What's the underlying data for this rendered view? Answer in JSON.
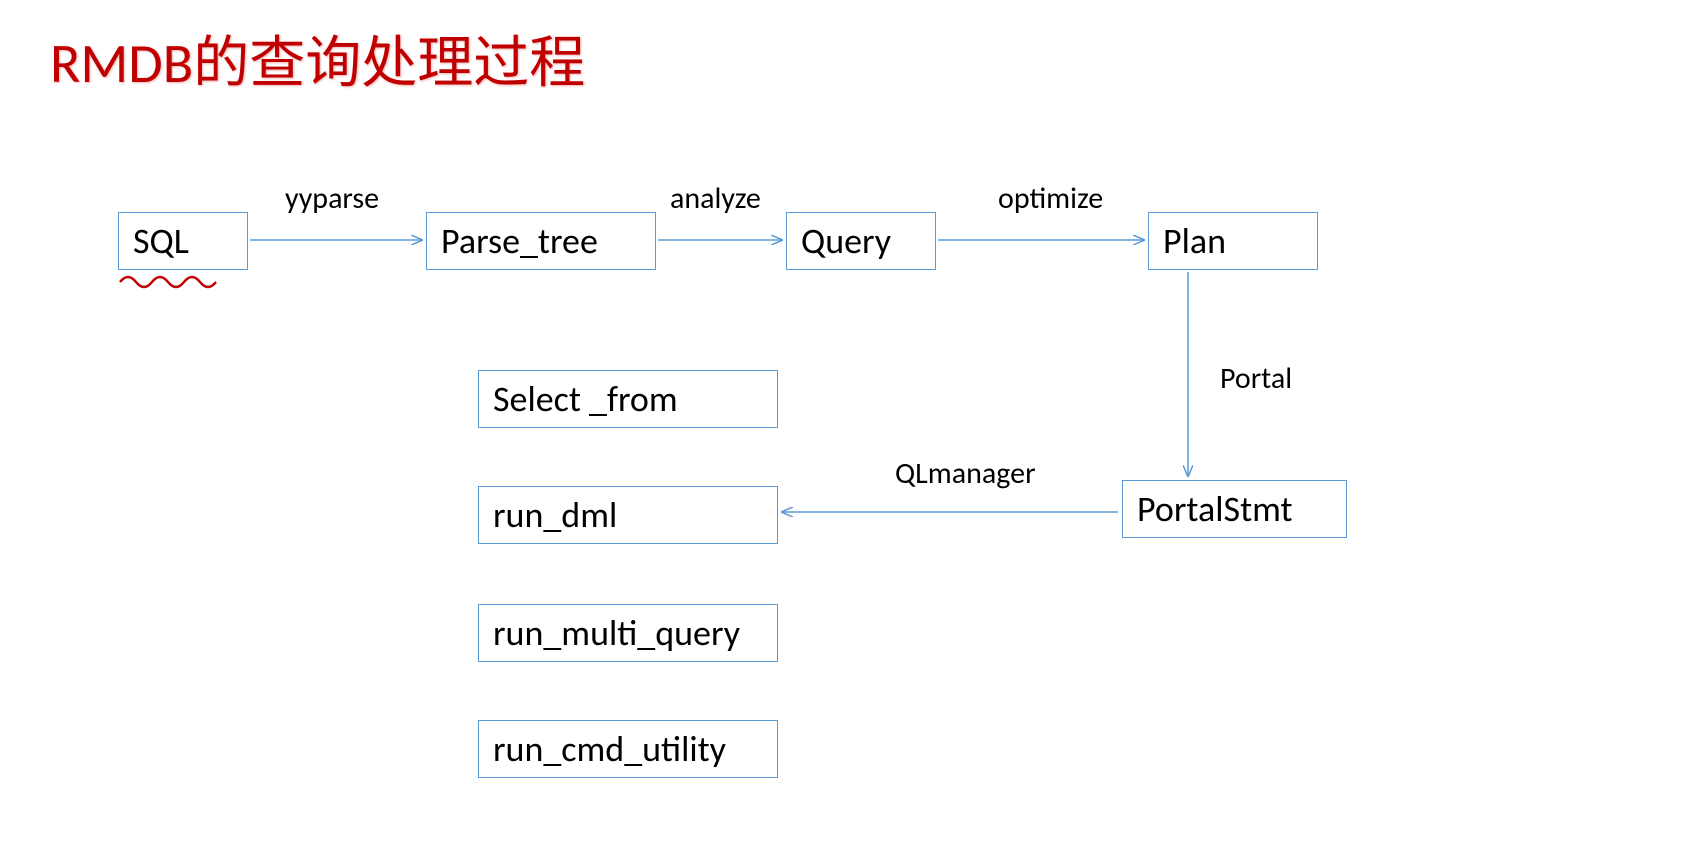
{
  "title": "RMDB的查询处理过程",
  "nodes": {
    "sql": "SQL",
    "parse_tree": "Parse_tree",
    "query": "Query",
    "plan": "Plan",
    "portal_stmt": "PortalStmt",
    "select_from": "Select _from",
    "run_dml": "run_dml",
    "run_multi_query": "run_multi_query",
    "run_cmd_utility": "run_cmd_utility"
  },
  "edges": {
    "yyparse": "yyparse",
    "analyze": "analyze",
    "optimize": "optimize",
    "portal": "Portal",
    "qlmanager": "QLmanager"
  }
}
